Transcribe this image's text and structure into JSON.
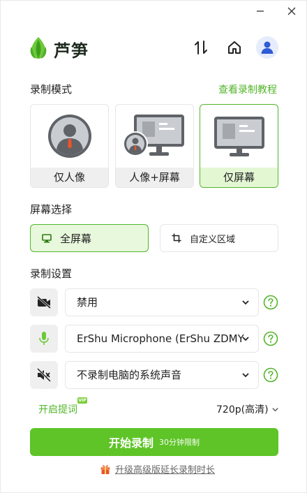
{
  "app": {
    "brand": "芦笋"
  },
  "window_controls": {
    "minimize": "—",
    "close": "✕"
  },
  "record_mode": {
    "title": "录制模式",
    "tutorial_link": "查看录制教程",
    "options": [
      {
        "label": "仅人像",
        "selected": false
      },
      {
        "label": "人像+屏幕",
        "selected": false
      },
      {
        "label": "仅屏幕",
        "selected": true
      }
    ]
  },
  "screen_select": {
    "title": "屏幕选择",
    "options": [
      {
        "label": "全屏幕",
        "selected": true,
        "icon": "monitor-icon"
      },
      {
        "label": "自定义区域",
        "selected": false,
        "icon": "crop-icon"
      }
    ]
  },
  "record_settings": {
    "title": "录制设置",
    "camera": {
      "value": "禁用",
      "icon": "camera-off-icon"
    },
    "microphone": {
      "value": "ErShu Microphone (ErShu ZDMY",
      "icon": "microphone-icon"
    },
    "system_audio": {
      "value": "不录制电脑的系统声音",
      "icon": "speaker-muted-icon"
    }
  },
  "footer": {
    "prompter": "开启提词",
    "vip": "VIP",
    "quality": "720p(高清)",
    "start_button": "开始录制",
    "start_limit": "30分钟限制",
    "upgrade": "升级高级版延长录制时长"
  },
  "colors": {
    "accent": "#52b52a",
    "button": "#5ec427",
    "selected_bg": "#e3f7d3",
    "avatar": "#2f5bd6"
  }
}
